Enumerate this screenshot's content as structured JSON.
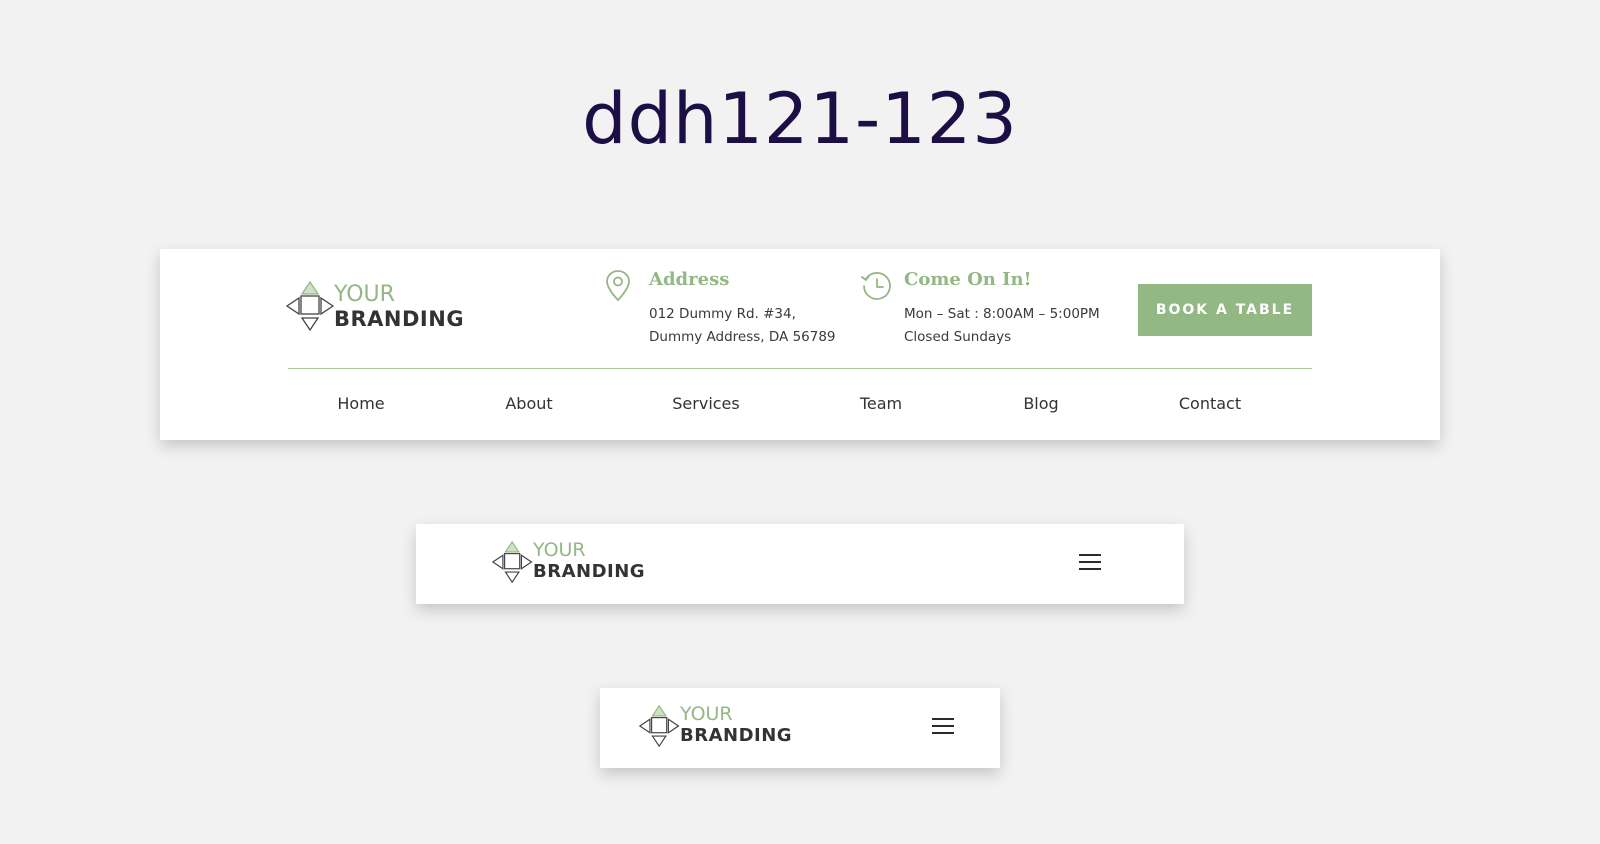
{
  "title": "ddh121-123",
  "brand": {
    "top": "YOUR",
    "bottom": "BRANDING"
  },
  "address": {
    "title": "Address",
    "line1": "012 Dummy Rd. #34,",
    "line2": "Dummy Address, DA 56789"
  },
  "hours": {
    "title": "Come On In!",
    "line1": "Mon – Sat : 8:00AM – 5:00PM",
    "line2": "Closed Sundays"
  },
  "cta": {
    "label": "BOOK A TABLE"
  },
  "nav": [
    "Home",
    "About",
    "Services",
    "Team",
    "Blog",
    "Contact"
  ],
  "icons": {
    "address": "location-pin-icon",
    "hours": "history-clock-icon",
    "menu": "hamburger-menu-icon"
  },
  "colors": {
    "accent": "#93b884",
    "title": "#1c0f45",
    "text": "#333333",
    "background": "#f2f2f2"
  }
}
